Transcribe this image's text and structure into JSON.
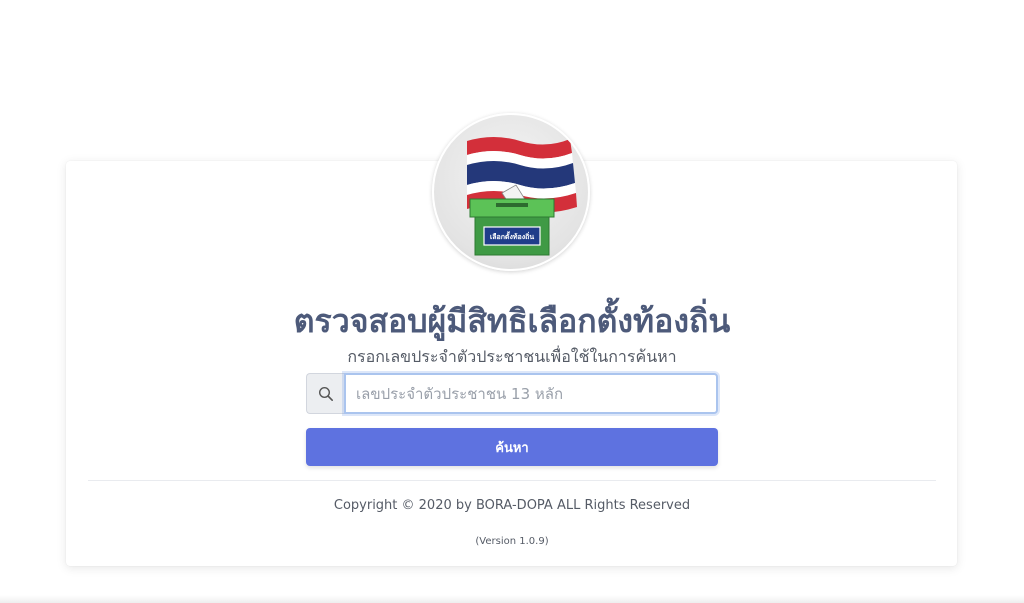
{
  "logo": {
    "ballot_label": "เลือกตั้งท้องถิ่น",
    "flag_colors": [
      "#d32f3a",
      "#ffffff",
      "#24387a"
    ],
    "box_color": "#3f9a45"
  },
  "header": {
    "title": "ตรวจสอบผู้มีสิทธิเลือกตั้งท้องถิ่น",
    "subtitle": "กรอกเลขประจำตัวประชาชนเพื่อใช้ในการค้นหา"
  },
  "search": {
    "icon": "search-icon",
    "placeholder": "เลขประจำตัวประชาชน 13 หลัก",
    "value": "",
    "button_label": "ค้นหา"
  },
  "footer": {
    "copyright": "Copyright © 2020 by BORA-DOPA ALL Rights Reserved",
    "version": "(Version 1.0.9)"
  },
  "colors": {
    "primary": "#5e72e0",
    "title": "#4d5a7a",
    "text": "#555b66"
  }
}
